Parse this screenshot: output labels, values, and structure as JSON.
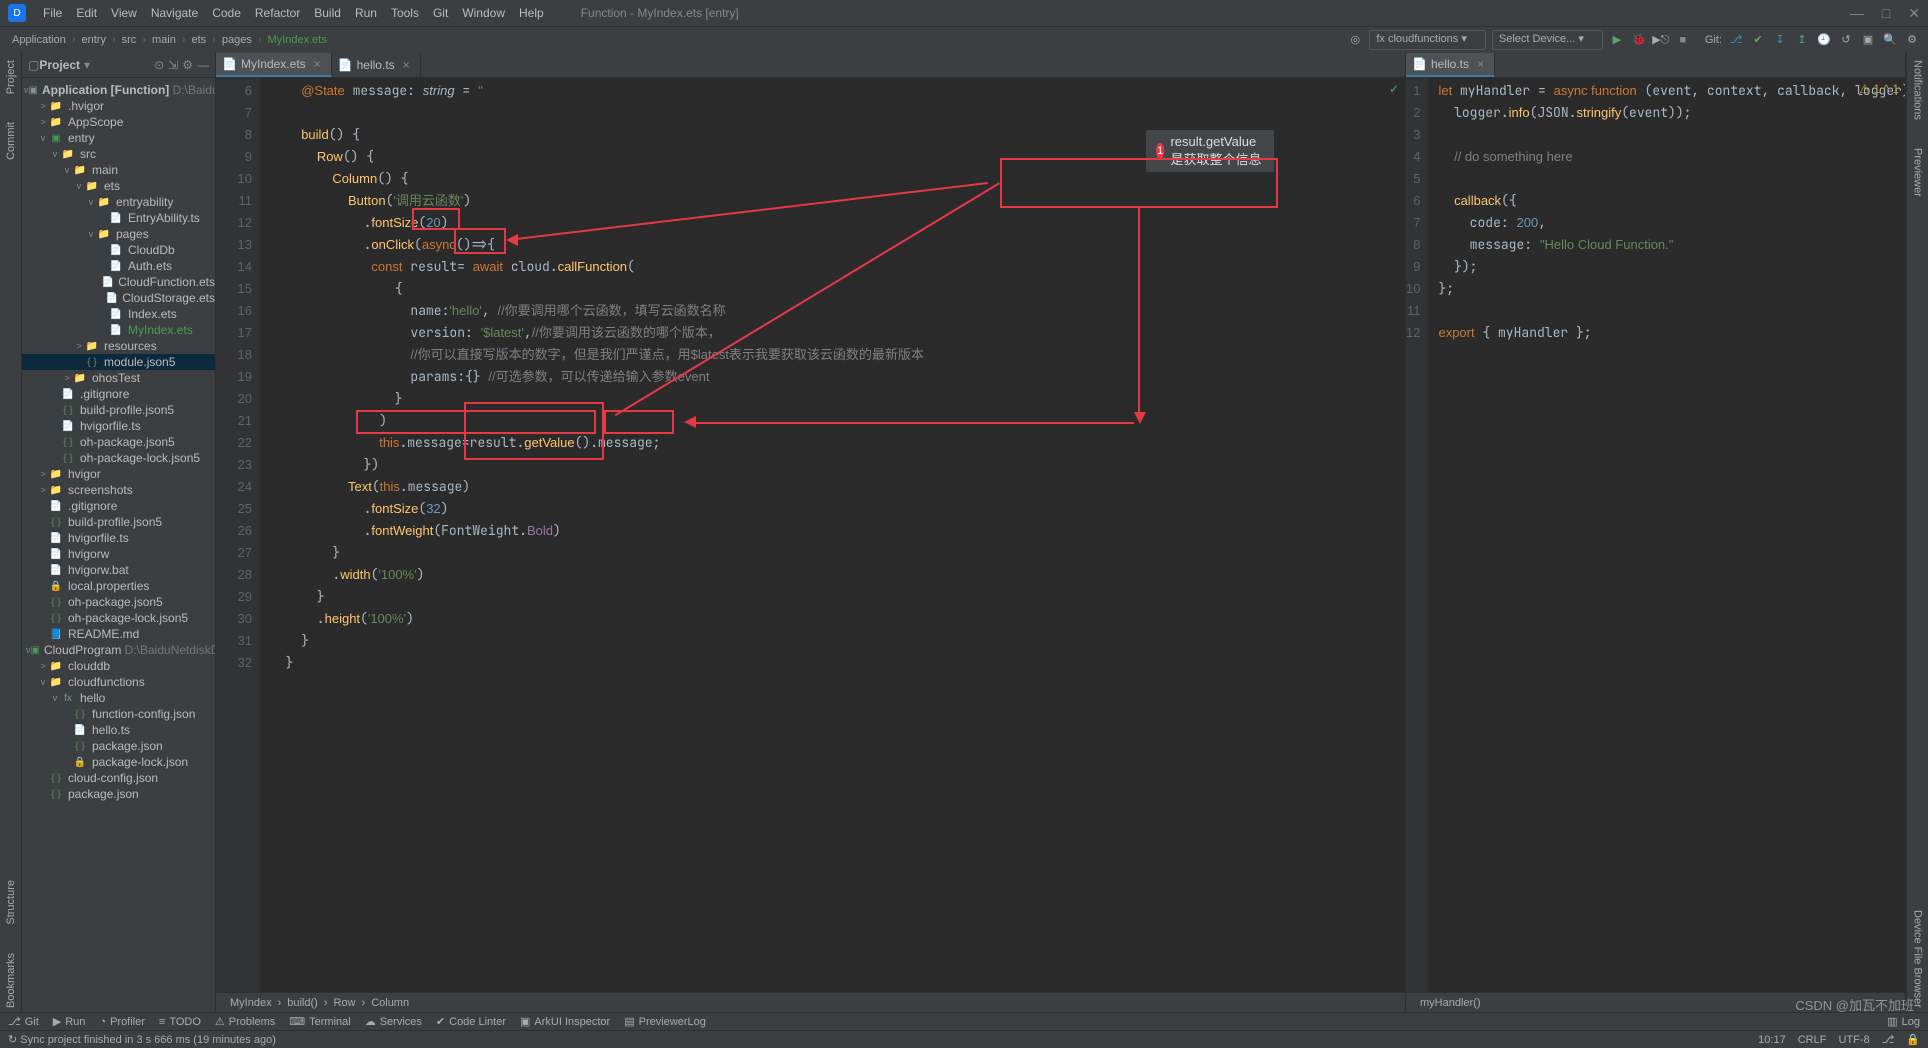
{
  "menu": {
    "items": [
      "File",
      "Edit",
      "View",
      "Navigate",
      "Code",
      "Refactor",
      "Build",
      "Run",
      "Tools",
      "Git",
      "Window",
      "Help"
    ],
    "title": "Function - MyIndex.ets [entry]"
  },
  "winbtns": [
    "—",
    "□",
    "✕"
  ],
  "toolbar": {
    "crumbs": [
      "Application",
      "entry",
      "src",
      "main",
      "ets",
      "pages",
      "MyIndex.ets"
    ],
    "dd_fx": "cloudfunctions",
    "dd_dev": "Select Device...",
    "git_label": "Git:"
  },
  "project": {
    "title": "Project",
    "rootA": {
      "name": "Application [Function]",
      "sub": "D:\\BaiduNet"
    },
    "tree": [
      {
        "d": 1,
        "a": ">",
        "t": "folder",
        "n": ".hvigor"
      },
      {
        "d": 1,
        "a": ">",
        "t": "folder",
        "n": "AppScope"
      },
      {
        "d": 1,
        "a": "v",
        "t": "module",
        "n": "entry"
      },
      {
        "d": 2,
        "a": "v",
        "t": "folder",
        "n": "src"
      },
      {
        "d": 3,
        "a": "v",
        "t": "folder",
        "n": "main"
      },
      {
        "d": 4,
        "a": "v",
        "t": "folder",
        "n": "ets"
      },
      {
        "d": 5,
        "a": "v",
        "t": "folder",
        "n": "entryability"
      },
      {
        "d": 6,
        "a": "",
        "t": "ts",
        "n": "EntryAbility.ts"
      },
      {
        "d": 5,
        "a": "v",
        "t": "folder",
        "n": "pages"
      },
      {
        "d": 6,
        "a": "",
        "t": "ts",
        "n": "CloudDb"
      },
      {
        "d": 6,
        "a": "",
        "t": "ts",
        "n": "Auth.ets"
      },
      {
        "d": 6,
        "a": "",
        "t": "ts",
        "n": "CloudFunction.ets"
      },
      {
        "d": 6,
        "a": "",
        "t": "ts",
        "n": "CloudStorage.ets"
      },
      {
        "d": 6,
        "a": "",
        "t": "ts",
        "n": "Index.ets"
      },
      {
        "d": 6,
        "a": "",
        "t": "ts",
        "n": "MyIndex.ets",
        "hl": true
      },
      {
        "d": 4,
        "a": ">",
        "t": "folder",
        "n": "resources"
      },
      {
        "d": 4,
        "a": "",
        "t": "json",
        "n": "module.json5",
        "sel": true
      },
      {
        "d": 3,
        "a": ">",
        "t": "folder",
        "n": "ohosTest"
      },
      {
        "d": 2,
        "a": "",
        "t": "file",
        "n": ".gitignore"
      },
      {
        "d": 2,
        "a": "",
        "t": "json",
        "n": "build-profile.json5"
      },
      {
        "d": 2,
        "a": "",
        "t": "ts",
        "n": "hvigorfile.ts"
      },
      {
        "d": 2,
        "a": "",
        "t": "json",
        "n": "oh-package.json5"
      },
      {
        "d": 2,
        "a": "",
        "t": "json",
        "n": "oh-package-lock.json5"
      },
      {
        "d": 1,
        "a": ">",
        "t": "folder",
        "n": "hvigor"
      },
      {
        "d": 1,
        "a": ">",
        "t": "folder",
        "n": "screenshots"
      },
      {
        "d": 1,
        "a": "",
        "t": "file",
        "n": ".gitignore"
      },
      {
        "d": 1,
        "a": "",
        "t": "json",
        "n": "build-profile.json5"
      },
      {
        "d": 1,
        "a": "",
        "t": "ts",
        "n": "hvigorfile.ts"
      },
      {
        "d": 1,
        "a": "",
        "t": "file",
        "n": "hvigorw"
      },
      {
        "d": 1,
        "a": "",
        "t": "file",
        "n": "hvigorw.bat"
      },
      {
        "d": 1,
        "a": "",
        "t": "lock",
        "n": "local.properties"
      },
      {
        "d": 1,
        "a": "",
        "t": "json",
        "n": "oh-package.json5"
      },
      {
        "d": 1,
        "a": "",
        "t": "json",
        "n": "oh-package-lock.json5"
      },
      {
        "d": 1,
        "a": "",
        "t": "md",
        "n": "README.md"
      },
      {
        "d": 0,
        "a": "v",
        "t": "module",
        "n": "CloudProgram",
        "sub": "D:\\BaiduNetdiskDow"
      },
      {
        "d": 1,
        "a": ">",
        "t": "folder",
        "n": "clouddb"
      },
      {
        "d": 1,
        "a": "v",
        "t": "folder",
        "n": "cloudfunctions"
      },
      {
        "d": 2,
        "a": "v",
        "t": "fx",
        "n": "hello"
      },
      {
        "d": 3,
        "a": "",
        "t": "json",
        "n": "function-config.json"
      },
      {
        "d": 3,
        "a": "",
        "t": "ts",
        "n": "hello.ts"
      },
      {
        "d": 3,
        "a": "",
        "t": "json",
        "n": "package.json"
      },
      {
        "d": 3,
        "a": "",
        "t": "lock",
        "n": "package-lock.json"
      },
      {
        "d": 1,
        "a": "",
        "t": "json",
        "n": "cloud-config.json"
      },
      {
        "d": 1,
        "a": "",
        "t": "json",
        "n": "package.json"
      }
    ]
  },
  "leftEditor": {
    "tabs": [
      {
        "label": "MyIndex.ets",
        "act": true
      },
      {
        "label": "hello.ts",
        "act": false
      }
    ],
    "startLine": 6,
    "crumbs": [
      "MyIndex",
      "build()",
      "Row",
      "Column"
    ]
  },
  "rightEditor": {
    "tabs": [
      {
        "label": "hello.ts",
        "act": true
      }
    ],
    "startLine": 1,
    "crumb": "myHandler()"
  },
  "bubble": {
    "num": "1",
    "text": "result.getValue是获取整个信息"
  },
  "leftTabs": [
    "Project",
    "Commit"
  ],
  "leftTabsB": [
    "Structure",
    "Bookmarks"
  ],
  "rightTabs": [
    "Notifications",
    "Previewer"
  ],
  "rightTabsB": [
    "Device File Browser"
  ],
  "bottom": {
    "items": [
      "Git",
      "Run",
      "Profiler",
      "TODO",
      "Problems",
      "Terminal",
      "Services",
      "Code Linter",
      "ArkUI Inspector",
      "PreviewerLog"
    ],
    "log": "Log"
  },
  "status": {
    "msg": "Sync project finished in 3 s 666 ms (19 minutes ago)",
    "pos": "10:17",
    "crlf": "CRLF",
    "enc": "UTF-8",
    "branch": " "
  },
  "watermark": "CSDN @加瓦不加班"
}
